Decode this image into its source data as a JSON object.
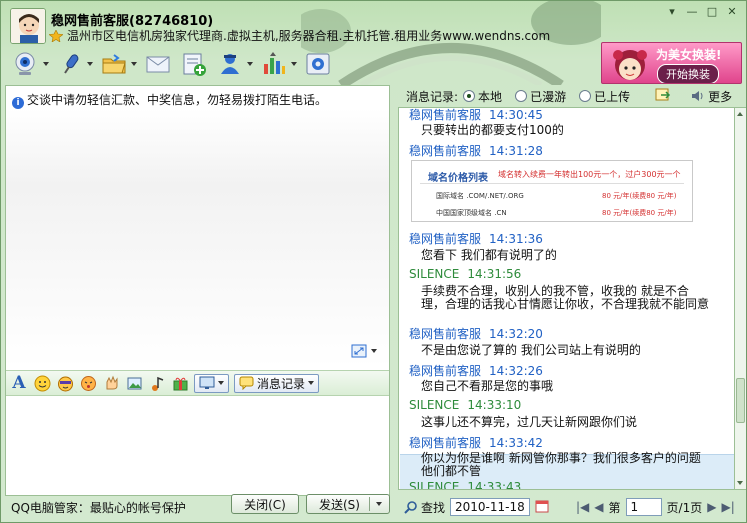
{
  "window": {
    "contact_name": "稳网售前客服(82746810)",
    "signature": "温州市区电信机房独家代理商.虚拟主机,服务器合租.主机托管.租用业务www.wendns.com",
    "controls": [
      "▾",
      "—",
      "□",
      "✕"
    ]
  },
  "promo": {
    "title": "为美女换装!",
    "button": "开始换装"
  },
  "toolbar": {
    "icons": [
      "video-camera-icon",
      "microphone-icon",
      "folder-icon",
      "mail-icon",
      "add-app-icon",
      "user-card-icon",
      "apps-icon",
      "settings-icon"
    ]
  },
  "left": {
    "warning": "交谈中请勿轻信汇款、中奖信息，勿轻易拨打陌生电话。",
    "message_record_label": "消息记录",
    "footer_text": "QQ电脑管家：最贴心的帐号保护",
    "close_button": "关闭(C)",
    "send_button": "发送(S)"
  },
  "right": {
    "record_label": "消息记录:",
    "options": [
      "本地",
      "已漫游",
      "已上传"
    ],
    "selected": "本地",
    "more": "更多",
    "search": "查找",
    "date": "2010-11-18",
    "page_label": "第",
    "page_value": "1",
    "page_total": "页/1页"
  },
  "price_image": {
    "title": "域名价格列表",
    "promo": "域名转入续费一年转出100元一个，过户300元一个",
    "rows": [
      {
        "label": "国际域名 .COM/.NET/.ORG",
        "price": "80 元/年(续费80 元/年)"
      },
      {
        "label": "中国国家顶级域名 .CN",
        "price": "80 元/年(续费80 元/年)"
      }
    ]
  },
  "messages": [
    {
      "sender": "稳网售前客服",
      "time": "14:30:45",
      "text": "只要转出的都要支付100的",
      "self": false
    },
    {
      "sender": "稳网售前客服",
      "time": "14:31:28",
      "text": "",
      "self": false
    },
    {
      "sender": "稳网售前客服",
      "time": "14:31:36",
      "text": "您看下    我们都有说明了的",
      "self": false
    },
    {
      "sender": "SILENCE",
      "time": "14:31:56",
      "text": "",
      "self": true
    },
    {
      "sender": "",
      "time": "",
      "text": "手续费不合理，收别人的我不管，收我的 就是不合理，合理的话我心甘情愿让你收，不合理我就不能同意",
      "self": true
    },
    {
      "sender": "稳网售前客服",
      "time": "14:32:20",
      "text": "不是由您说了算的  我们公司站上有说明的",
      "self": false
    },
    {
      "sender": "稳网售前客服",
      "time": "14:32:26",
      "text": "您自己不看那是您的事哦",
      "self": false
    },
    {
      "sender": "SILENCE",
      "time": "14:33:10",
      "text": "这事儿还不算完，过几天让新网跟你们说",
      "self": true
    },
    {
      "sender": "稳网售前客服",
      "time": "14:33:42",
      "text": "你以为你是谁啊    新网管你那事？我们很多客户的问题他们都不管",
      "self": false
    },
    {
      "sender": "SILENCE",
      "time": "14:33:43",
      "text": "",
      "self": true
    }
  ]
}
